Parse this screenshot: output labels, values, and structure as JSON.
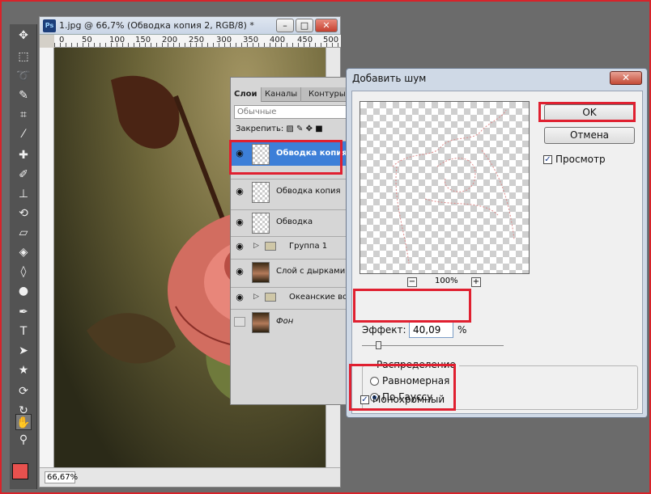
{
  "document": {
    "title": "1.jpg @ 66,7% (Обводка копия 2, RGB/8) *",
    "ps_badge": "Ps",
    "minimize": "–",
    "maximize": "□",
    "close": "✕",
    "ruler_ticks": [
      "0",
      "50",
      "100",
      "150",
      "200",
      "250",
      "300",
      "350",
      "400",
      "450",
      "500"
    ],
    "zoom": "66,67%"
  },
  "layers_panel": {
    "tabs": [
      "Слои",
      "Каналы",
      "Контуры"
    ],
    "blend_mode": "Обычные",
    "lock_label": "Закрепить:",
    "layers": [
      {
        "name": "Обводка копия",
        "type": "layer",
        "visible": true,
        "selected": true
      },
      {
        "name": "Обводка копия",
        "type": "layer",
        "visible": true,
        "selected": false
      },
      {
        "name": "Обводка",
        "type": "layer",
        "visible": true,
        "selected": false
      },
      {
        "name": "Группа 1",
        "type": "group",
        "visible": true,
        "selected": false
      },
      {
        "name": "Слой с дырками",
        "type": "photo",
        "visible": true,
        "selected": false
      },
      {
        "name": "Океанские вол",
        "type": "group",
        "visible": true,
        "selected": false
      },
      {
        "name": "Фон",
        "type": "photo",
        "visible": false,
        "selected": false
      }
    ]
  },
  "dialog": {
    "title": "Добавить шум",
    "close": "✕",
    "ok": "OK",
    "cancel": "Отмена",
    "preview_label": "Просмотр",
    "preview_checked": true,
    "zoom_minus": "−",
    "zoom_plus": "+",
    "zoom_pct": "100%",
    "amount_label": "Эффект:",
    "amount_value": "40,09",
    "amount_unit": "%",
    "distribution_label": "Распределение",
    "uniform": "Равномерная",
    "gaussian": "По Гауссу",
    "gaussian_selected": true,
    "mono": "Монохромный",
    "mono_checked": true
  },
  "colors": {
    "highlight": "#e02030",
    "selection": "#3d7fd8",
    "foreground": "#e8514e"
  }
}
